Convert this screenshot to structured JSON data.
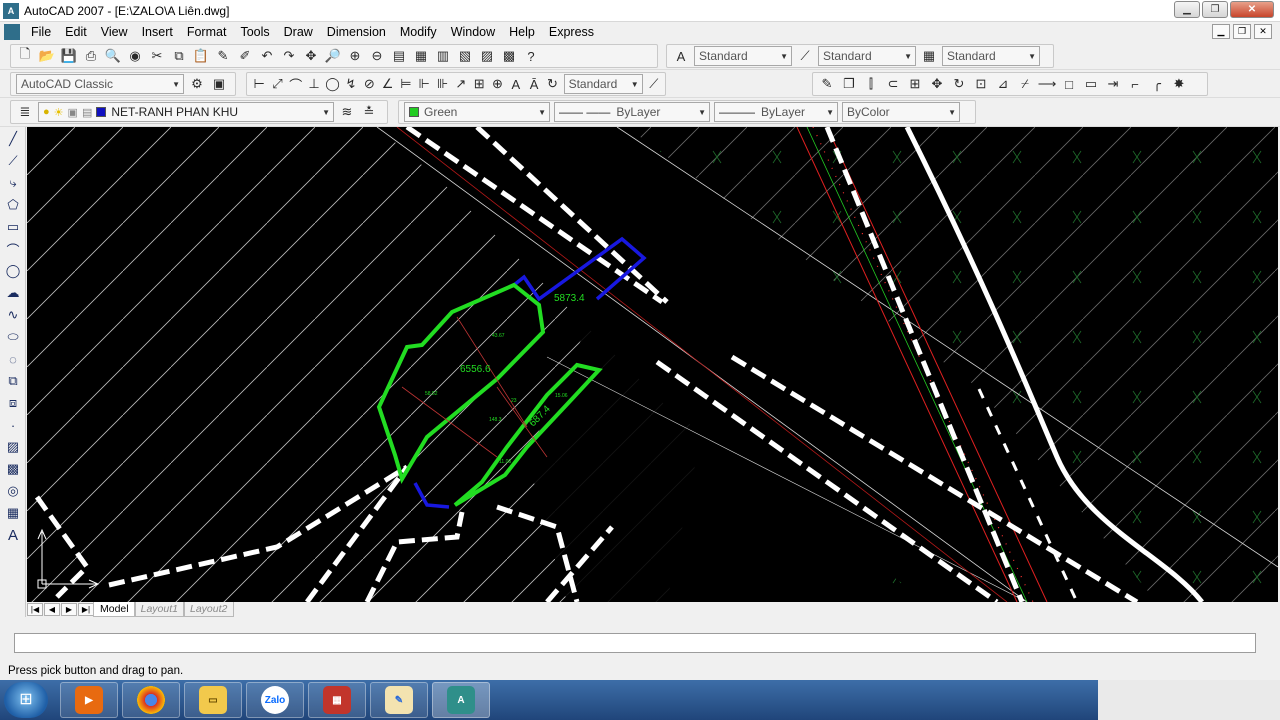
{
  "window": {
    "title": "AutoCAD 2007 - [E:\\ZALO\\A Liên.dwg]",
    "app_icon": "autocad-icon"
  },
  "menu": [
    "File",
    "Edit",
    "View",
    "Insert",
    "Format",
    "Tools",
    "Draw",
    "Dimension",
    "Modify",
    "Window",
    "Help",
    "Express"
  ],
  "styles_toolbar": {
    "text_style": "Standard",
    "dim_style": "Standard",
    "table_style": "Standard"
  },
  "workspace": {
    "name": "AutoCAD Classic"
  },
  "properties_toolbar": {
    "layer_style": "Standard"
  },
  "layers": {
    "current_layer": "NET-RANH PHAN KHU",
    "color": "Green",
    "linetype": "ByLayer",
    "lineweight": "ByLayer",
    "plot_style": "ByColor"
  },
  "drawing": {
    "area_labels": [
      "5873.4",
      "6556.6",
      "687.4"
    ],
    "small_labels": [
      "43.67",
      "58.52",
      "148.3",
      "15.06",
      "11.06",
      "23"
    ],
    "colors": {
      "background": "#000000",
      "parcel": "#22dd22",
      "boundary_blue": "#2020e0",
      "road": "#ffffff",
      "hatch": "#cfcfcf",
      "red_line": "#ff2020"
    }
  },
  "layout_tabs": [
    "Model",
    "Layout1",
    "Layout2"
  ],
  "status_text": "Press pick button and drag to pan.",
  "taskbar": {
    "apps": [
      "Windows Media Player",
      "Google Chrome",
      "File Explorer",
      "Zalo",
      "WinRAR",
      "Paint",
      "AutoCAD"
    ],
    "zalo_label": "Zalo"
  }
}
